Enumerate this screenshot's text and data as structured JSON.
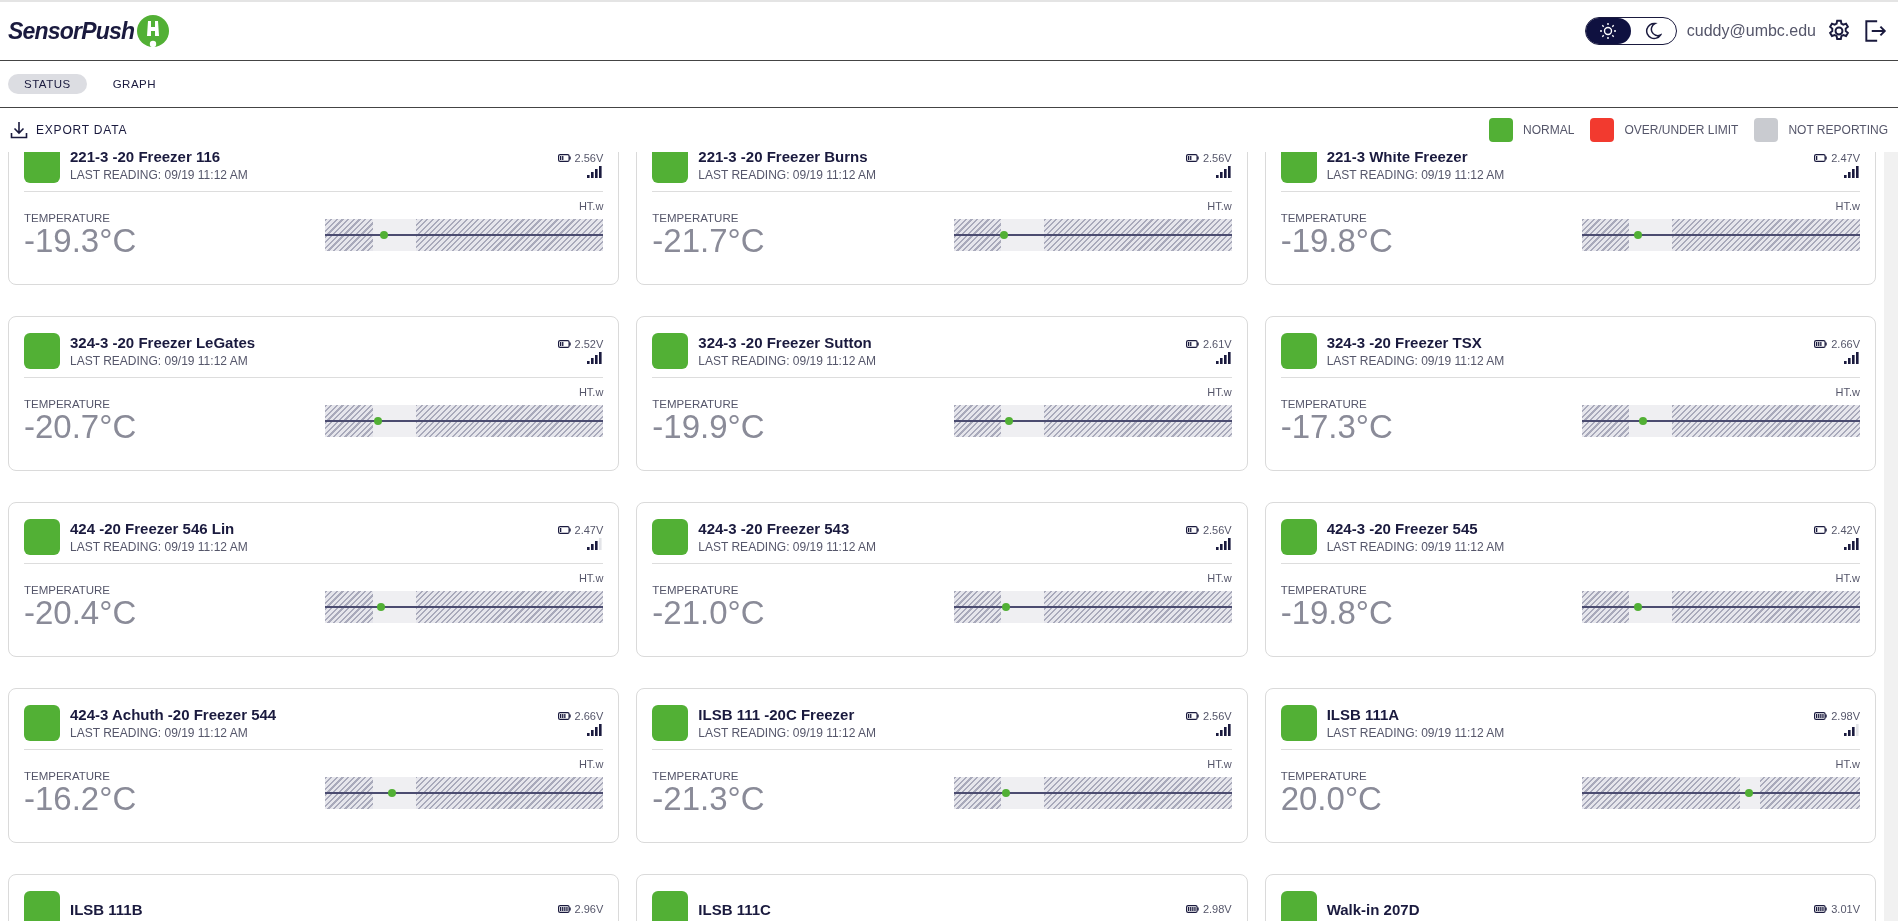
{
  "brand": {
    "name": "SensorPush"
  },
  "header": {
    "dark_mode": false,
    "user": "cuddy@umbc.edu"
  },
  "tabs": [
    {
      "label": "STATUS",
      "selected": true
    },
    {
      "label": "GRAPH",
      "selected": false
    }
  ],
  "toolbar": {
    "export": "EXPORT DATA"
  },
  "legend": [
    {
      "label": "NORMAL",
      "color": "#52b035"
    },
    {
      "label": "OVER/UNDER LIMIT",
      "color": "#f23a2f"
    },
    {
      "label": "NOT REPORTING",
      "color": "#c9cbd0"
    }
  ],
  "sensors": [
    {
      "name": "221-3 -20 Freezer 116",
      "last_reading": "LAST READING: 09/19 11:12 AM",
      "voltage": "2.56V",
      "battery": {
        "kind": "half"
      },
      "signal": {
        "kind": "strong"
      },
      "model": "HT.w",
      "metric": "TEMPERATURE",
      "value": "-19.3°C",
      "color": "#52b035",
      "gauge": {
        "kind": "freezer",
        "level": 0.21
      }
    },
    {
      "name": "221-3 -20 Freezer Burns",
      "last_reading": "LAST READING: 09/19 11:12 AM",
      "voltage": "2.56V",
      "battery": {
        "kind": "half"
      },
      "signal": {
        "kind": "strong"
      },
      "model": "HT.w",
      "metric": "TEMPERATURE",
      "value": "-21.7°C",
      "color": "#52b035",
      "gauge": {
        "kind": "freezer",
        "level": 0.18
      }
    },
    {
      "name": "221-3 White Freezer",
      "last_reading": "LAST READING: 09/19 11:12 AM",
      "voltage": "2.47V",
      "battery": {
        "kind": "low"
      },
      "signal": {
        "kind": "strong"
      },
      "model": "HT.w",
      "metric": "TEMPERATURE",
      "value": "-19.8°C",
      "color": "#52b035",
      "gauge": {
        "kind": "freezer",
        "level": 0.2
      }
    },
    {
      "name": "324-3 -20 Freezer LeGates",
      "last_reading": "LAST READING: 09/19 11:12 AM",
      "voltage": "2.52V",
      "battery": {
        "kind": "half"
      },
      "signal": {
        "kind": "strong"
      },
      "model": "HT.w",
      "metric": "TEMPERATURE",
      "value": "-20.7°C",
      "color": "#52b035",
      "gauge": {
        "kind": "freezer",
        "level": 0.19
      }
    },
    {
      "name": "324-3 -20 Freezer Sutton",
      "last_reading": "LAST READING: 09/19 11:12 AM",
      "voltage": "2.61V",
      "battery": {
        "kind": "half"
      },
      "signal": {
        "kind": "strong"
      },
      "model": "HT.w",
      "metric": "TEMPERATURE",
      "value": "-19.9°C",
      "color": "#52b035",
      "gauge": {
        "kind": "freezer",
        "level": 0.2
      }
    },
    {
      "name": "324-3 -20 Freezer TSX",
      "last_reading": "LAST READING: 09/19 11:12 AM",
      "voltage": "2.66V",
      "battery": {
        "kind": "good"
      },
      "signal": {
        "kind": "strong"
      },
      "model": "HT.w",
      "metric": "TEMPERATURE",
      "value": "-17.3°C",
      "color": "#52b035",
      "gauge": {
        "kind": "freezer",
        "level": 0.22
      }
    },
    {
      "name": "424 -20 Freezer 546 Lin",
      "last_reading": "LAST READING: 09/19 11:12 AM",
      "voltage": "2.47V",
      "battery": {
        "kind": "low"
      },
      "signal": {
        "kind": "good"
      },
      "model": "HT.w",
      "metric": "TEMPERATURE",
      "value": "-20.4°C",
      "color": "#52b035",
      "gauge": {
        "kind": "freezer",
        "level": 0.2
      }
    },
    {
      "name": "424-3 -20 Freezer 543",
      "last_reading": "LAST READING: 09/19 11:12 AM",
      "voltage": "2.56V",
      "battery": {
        "kind": "half"
      },
      "signal": {
        "kind": "strong"
      },
      "model": "HT.w",
      "metric": "TEMPERATURE",
      "value": "-21.0°C",
      "color": "#52b035",
      "gauge": {
        "kind": "freezer",
        "level": 0.19
      }
    },
    {
      "name": "424-3 -20 Freezer 545",
      "last_reading": "LAST READING: 09/19 11:12 AM",
      "voltage": "2.42V",
      "battery": {
        "kind": "low"
      },
      "signal": {
        "kind": "strong"
      },
      "model": "HT.w",
      "metric": "TEMPERATURE",
      "value": "-19.8°C",
      "color": "#52b035",
      "gauge": {
        "kind": "freezer",
        "level": 0.2
      }
    },
    {
      "name": "424-3 Achuth -20 Freezer 544",
      "last_reading": "LAST READING: 09/19 11:12 AM",
      "voltage": "2.66V",
      "battery": {
        "kind": "good"
      },
      "signal": {
        "kind": "strong"
      },
      "model": "HT.w",
      "metric": "TEMPERATURE",
      "value": "-16.2°C",
      "color": "#52b035",
      "gauge": {
        "kind": "freezer",
        "level": 0.24
      }
    },
    {
      "name": "ILSB 111 -20C Freezer",
      "last_reading": "LAST READING: 09/19 11:12 AM",
      "voltage": "2.56V",
      "battery": {
        "kind": "half"
      },
      "signal": {
        "kind": "strong"
      },
      "model": "HT.w",
      "metric": "TEMPERATURE",
      "value": "-21.3°C",
      "color": "#52b035",
      "gauge": {
        "kind": "freezer",
        "level": 0.19
      }
    },
    {
      "name": "ILSB 111A",
      "last_reading": "LAST READING: 09/19 11:12 AM",
      "voltage": "2.98V",
      "battery": {
        "kind": "full"
      },
      "signal": {
        "kind": "good"
      },
      "model": "HT.w",
      "metric": "TEMPERATURE",
      "value": "20.0°C",
      "color": "#52b035",
      "gauge": {
        "kind": "room",
        "level": 0.6
      }
    },
    {
      "name": "ILSB 111B",
      "voltage": "2.96V",
      "battery": {
        "kind": "full"
      },
      "color": "#52b035"
    },
    {
      "name": "ILSB 111C",
      "voltage": "2.98V",
      "battery": {
        "kind": "full"
      },
      "color": "#52b035"
    },
    {
      "name": "Walk-in 207D",
      "voltage": "3.01V",
      "battery": {
        "kind": "full"
      },
      "color": "#52b035"
    }
  ]
}
